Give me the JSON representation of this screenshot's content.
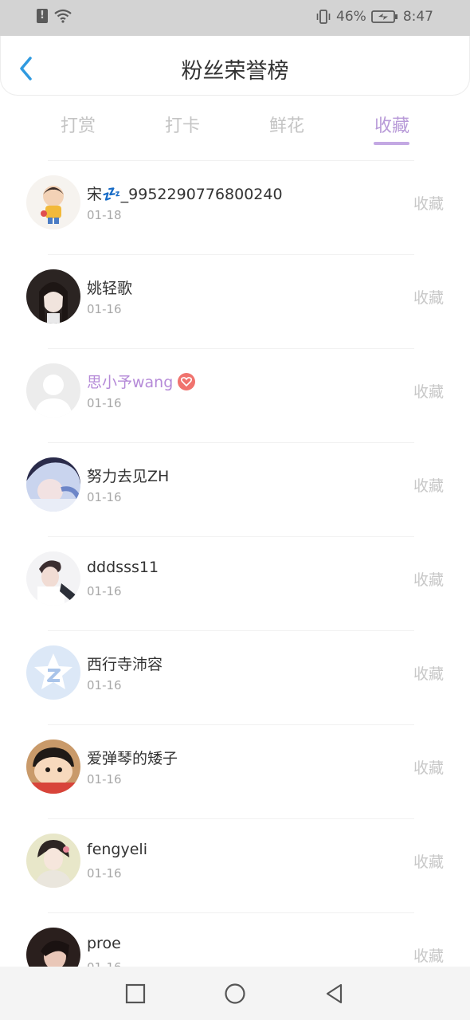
{
  "status_bar": {
    "battery": "46%",
    "time": "8:47",
    "icons": [
      "alert-icon",
      "wifi-icon",
      "vibrate-icon",
      "battery-icon"
    ]
  },
  "header": {
    "title": "粉丝荣誉榜",
    "back_icon": "chevron-left-icon"
  },
  "tabs": [
    {
      "label": "打赏",
      "active": false
    },
    {
      "label": "打卡",
      "active": false
    },
    {
      "label": "鲜花",
      "active": false
    },
    {
      "label": "收藏",
      "active": true
    }
  ],
  "list": {
    "items": [
      {
        "name": "宋💤_9952290776800240",
        "date": "01-18",
        "action": "收藏"
      },
      {
        "name": "姚轻歌",
        "date": "01-16",
        "action": "收藏"
      },
      {
        "name": "思小予wang",
        "date": "01-16",
        "action": "收藏",
        "vip": true
      },
      {
        "name": "努力去见ZH",
        "date": "01-16",
        "action": "收藏"
      },
      {
        "name": "dddsss11",
        "date": "01-16",
        "action": "收藏"
      },
      {
        "name": "西行寺沛容",
        "date": "01-16",
        "action": "收藏"
      },
      {
        "name": "爱弹琴的矮子",
        "date": "01-16",
        "action": "收藏"
      },
      {
        "name": "fengyeli",
        "date": "01-16",
        "action": "收藏"
      },
      {
        "name": "proe",
        "date": "01-16",
        "action": "收藏"
      }
    ]
  },
  "nav_bar": {
    "icons": [
      "recent-apps-icon",
      "home-icon",
      "back-icon"
    ]
  },
  "colors": {
    "accent": "#b89ad8",
    "back_arrow": "#2f9ae0",
    "vip_name": "#b58ad8",
    "badge": "#f0736e"
  }
}
